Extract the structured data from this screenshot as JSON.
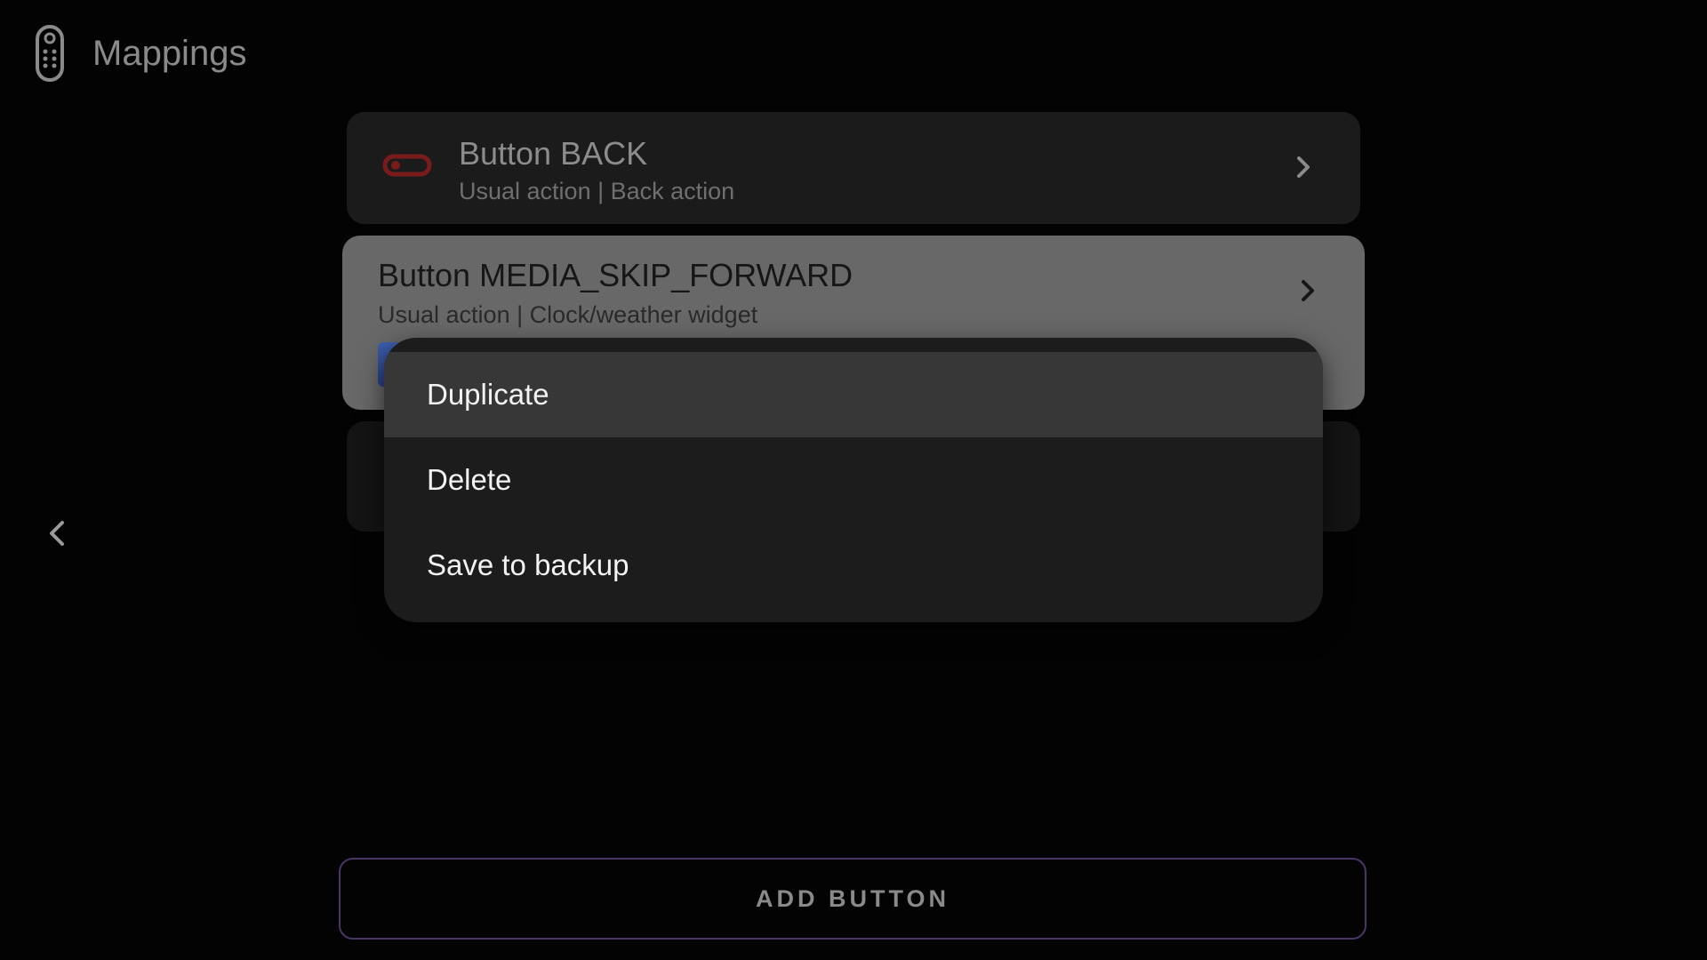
{
  "header": {
    "title": "Mappings",
    "icon": "remote-control-icon"
  },
  "mappings": [
    {
      "title": "Button BACK",
      "subtitle": "Usual action | Back action",
      "enabled": false,
      "toggle_color": "#7a1b1b"
    },
    {
      "title": "Button MEDIA_SKIP_FORWARD",
      "subtitle": "Usual action | Clock/weather widget",
      "focused": true
    }
  ],
  "context_menu": {
    "items": [
      {
        "label": "Duplicate",
        "selected": true
      },
      {
        "label": "Delete",
        "selected": false
      },
      {
        "label": "Save to backup",
        "selected": false
      }
    ]
  },
  "add_button": {
    "label": "ADD BUTTON",
    "border_color": "#4a3568"
  },
  "colors": {
    "background": "#030303",
    "card": "#1b1b1b",
    "card_focused": "#686868",
    "menu": "#1c1c1c",
    "menu_selected": "#373737"
  }
}
